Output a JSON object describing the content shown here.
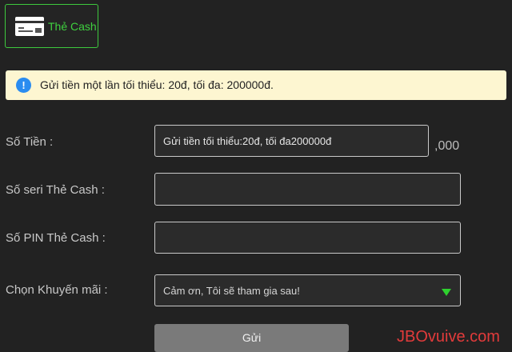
{
  "payment_method": {
    "label": "Thẻ Cash",
    "icon": "card-icon",
    "accent_color": "#3ec93e"
  },
  "notice": {
    "icon": "info-icon",
    "text": "Gửi tiền một lần tối thiểu: 20đ, tối đa: 200000đ."
  },
  "form": {
    "amount": {
      "label": "Số Tiền :",
      "placeholder": "Gửi tiền tối thiểu:20đ, tối đa200000đ",
      "suffix": ",000"
    },
    "serial": {
      "label": "Số seri Thẻ Cash :",
      "value": ""
    },
    "pin": {
      "label": "Số PIN Thẻ Cash :",
      "value": ""
    },
    "promotion": {
      "label": "Chọn Khuyến mãi :",
      "selected": "Cảm ơn, Tôi sẽ tham gia sau!"
    },
    "submit_label": "Gửi"
  },
  "watermark": "JBOvuive.com"
}
